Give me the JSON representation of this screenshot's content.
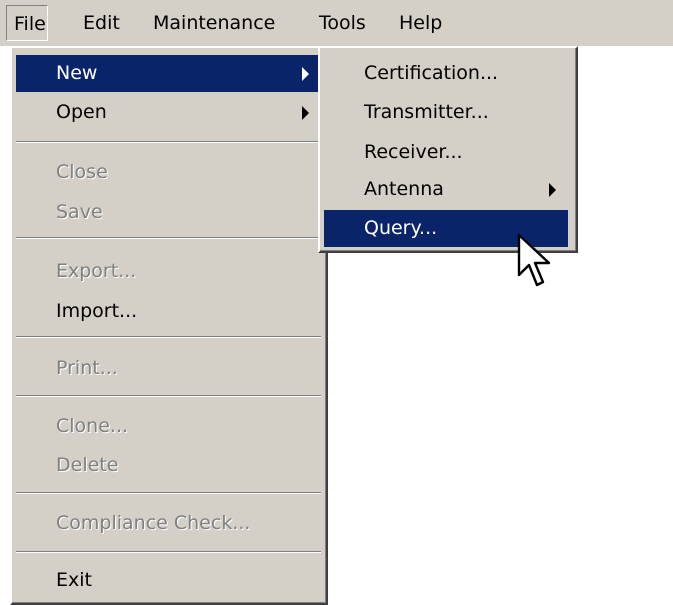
{
  "menubar": {
    "items": [
      "File",
      "Edit",
      "Maintenance",
      "Tools",
      "Help"
    ]
  },
  "file_menu": {
    "new": "New",
    "open": "Open",
    "close": "Close",
    "save": "Save",
    "export": "Export...",
    "import": "Import...",
    "print": "Print...",
    "clone": "Clone...",
    "delete": "Delete",
    "compliance_check": "Compliance Check...",
    "exit": "Exit"
  },
  "new_submenu": {
    "certification": "Certification...",
    "transmitter": "Transmitter...",
    "receiver": "Receiver...",
    "antenna": "Antenna",
    "query": "Query..."
  },
  "colors": {
    "menu_background": "#d4d0c8",
    "highlight": "#0a246a",
    "disabled_text": "#808080"
  }
}
